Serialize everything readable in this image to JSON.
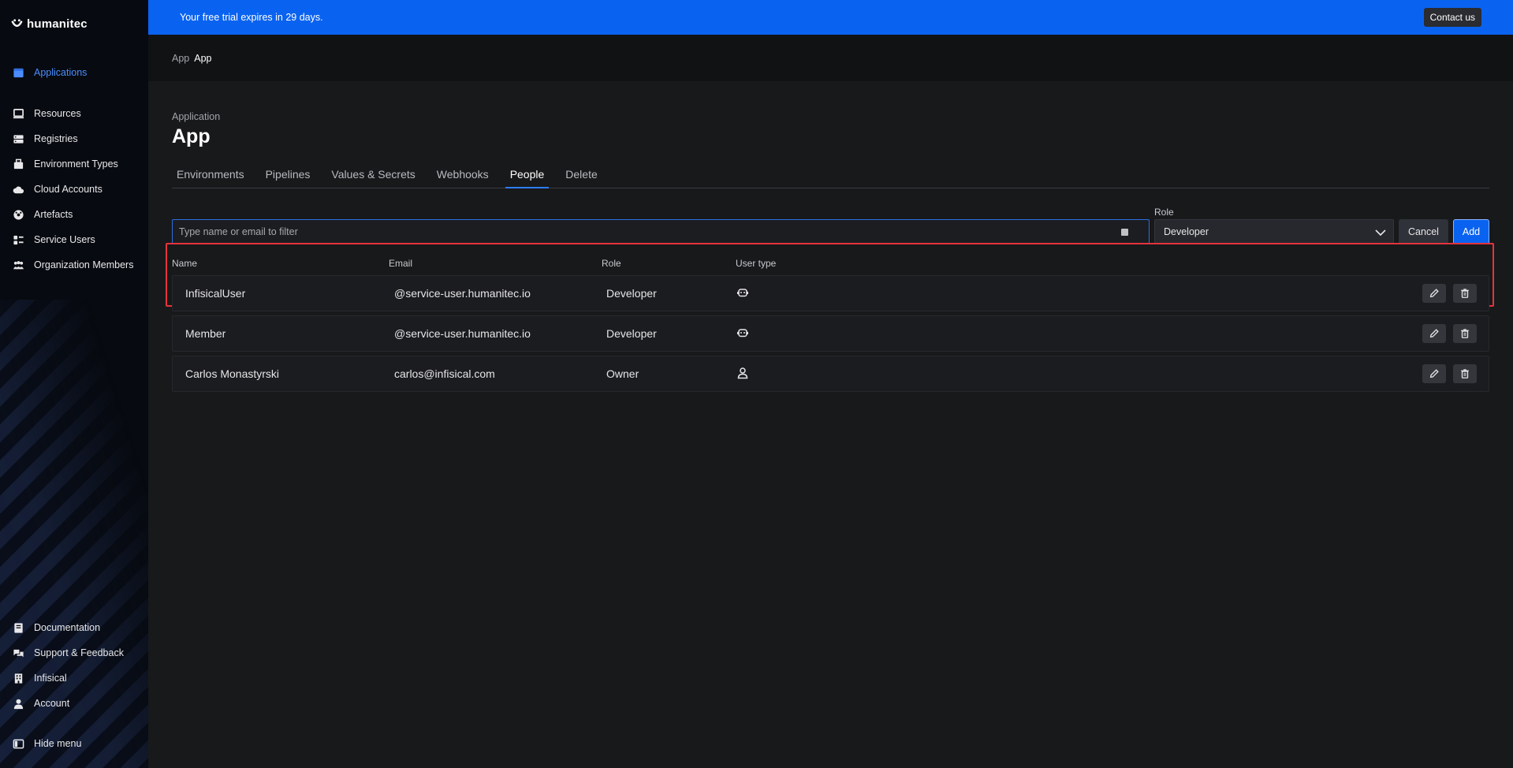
{
  "sidebar": {
    "logo_text": "humanitec",
    "items": [
      {
        "label": "Applications",
        "icon": "applications-icon",
        "active": true
      },
      {
        "label": "Resources",
        "icon": "resources-icon"
      },
      {
        "label": "Registries",
        "icon": "registries-icon"
      },
      {
        "label": "Environment Types",
        "icon": "environment-types-icon"
      },
      {
        "label": "Cloud Accounts",
        "icon": "cloud-accounts-icon"
      },
      {
        "label": "Artefacts",
        "icon": "artefacts-icon"
      },
      {
        "label": "Service Users",
        "icon": "service-users-icon"
      },
      {
        "label": "Organization Members",
        "icon": "organization-members-icon"
      }
    ],
    "bottom_items": [
      {
        "label": "Documentation",
        "icon": "documentation-icon"
      },
      {
        "label": "Support & Feedback",
        "icon": "support-icon"
      },
      {
        "label": "Infisical",
        "icon": "building-icon"
      },
      {
        "label": "Account",
        "icon": "account-icon"
      }
    ],
    "hide_menu_label": "Hide menu"
  },
  "banner": {
    "text": "Your free trial expires in 29 days.",
    "contact_label": "Contact us"
  },
  "breadcrumb": {
    "parent": "App",
    "current": "App"
  },
  "page": {
    "eyebrow": "Application",
    "title": "App"
  },
  "tabs": [
    {
      "label": "Environments"
    },
    {
      "label": "Pipelines"
    },
    {
      "label": "Values & Secrets"
    },
    {
      "label": "Webhooks"
    },
    {
      "label": "People",
      "active": true
    },
    {
      "label": "Delete"
    }
  ],
  "filter": {
    "placeholder": "Type name or email to filter",
    "value": ""
  },
  "role_select": {
    "label": "Role",
    "value": "Developer"
  },
  "buttons": {
    "cancel": "Cancel",
    "add": "Add"
  },
  "table": {
    "headers": {
      "name": "Name",
      "email": "Email",
      "role": "Role",
      "user_type": "User type"
    },
    "rows": [
      {
        "name": "InfisicalUser",
        "email": "@service-user.humanitec.io",
        "role": "Developer",
        "user_type": "robot-icon"
      },
      {
        "name": "Member",
        "email": "@service-user.humanitec.io",
        "role": "Developer",
        "user_type": "robot-icon"
      },
      {
        "name": "Carlos Monastyrski",
        "email": "carlos@infisical.com",
        "role": "Owner",
        "user_type": "person-icon"
      }
    ]
  },
  "colors": {
    "accent": "#0a63f0",
    "active_nav": "#4b8dff",
    "highlight": "#e5333d"
  }
}
